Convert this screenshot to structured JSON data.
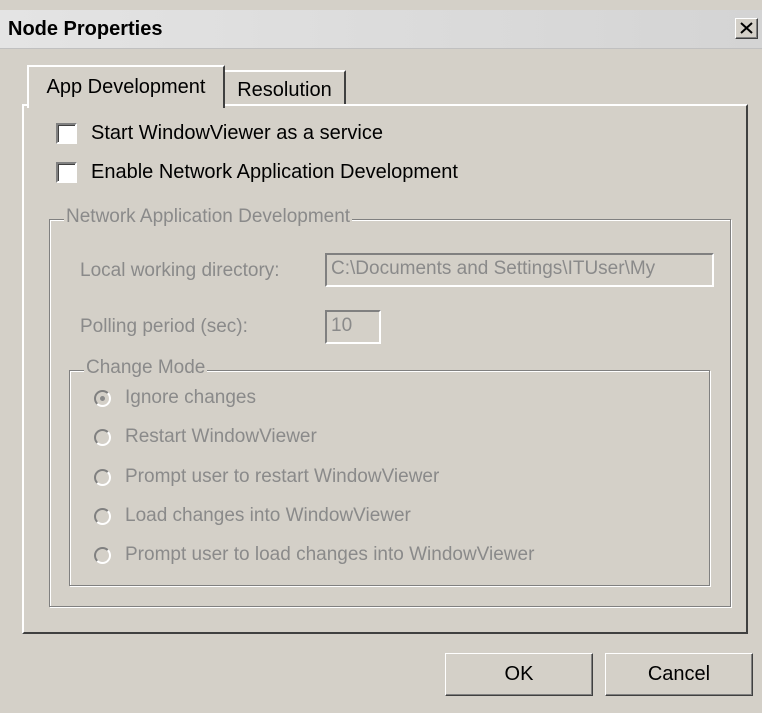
{
  "window": {
    "title": "Node Properties"
  },
  "tabs": [
    {
      "label": "App Development",
      "selected": true
    },
    {
      "label": "Resolution",
      "selected": false
    }
  ],
  "options": {
    "start_service": {
      "label": "Start WindowViewer as a service",
      "checked": false
    },
    "enable_nad": {
      "label": "Enable Network Application Development",
      "checked": false
    }
  },
  "nad_group": {
    "legend": "Network Application Development",
    "local_dir_label": "Local working directory:",
    "local_dir_value": "C:\\Documents and Settings\\ITUser\\My",
    "polling_label": "Polling period (sec):",
    "polling_value": "10",
    "change_mode": {
      "legend": "Change Mode",
      "selected_index": 0,
      "items": [
        "Ignore changes",
        "Restart WindowViewer",
        "Prompt user to restart WindowViewer",
        "Load changes into WindowViewer",
        "Prompt user to load changes into WindowViewer"
      ]
    }
  },
  "buttons": {
    "ok": "OK",
    "cancel": "Cancel"
  },
  "icons": {
    "close": "close-icon"
  }
}
